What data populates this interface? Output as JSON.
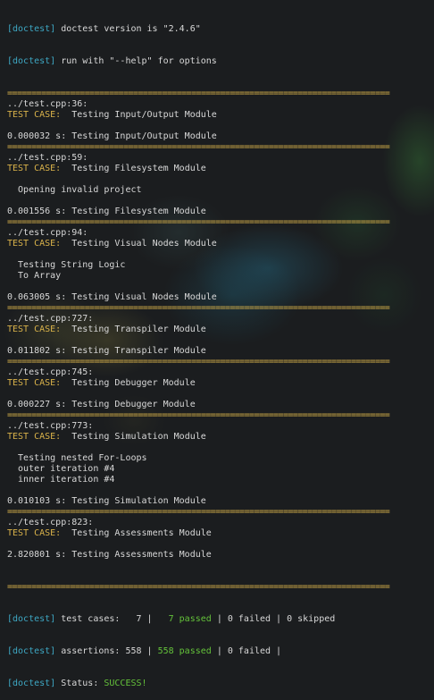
{
  "header": {
    "tag": "[doctest]",
    "version_text": " doctest version is \"2.4.6\"",
    "help_text": " run with \"--help\" for options"
  },
  "separator": "===============================================================================",
  "test_case_label": "TEST CASE:",
  "sections": [
    {
      "location": "../test.cpp:36:",
      "name": "  Testing Input/Output Module",
      "messages": [],
      "time": "0.000032 s: Testing Input/Output Module"
    },
    {
      "location": "../test.cpp:59:",
      "name": "  Testing Filesystem Module",
      "messages": [
        "  Opening invalid project"
      ],
      "time": "0.001556 s: Testing Filesystem Module"
    },
    {
      "location": "../test.cpp:94:",
      "name": "  Testing Visual Nodes Module",
      "messages": [
        "  Testing String Logic",
        "  To Array"
      ],
      "time": "0.063005 s: Testing Visual Nodes Module"
    },
    {
      "location": "../test.cpp:727:",
      "name": "  Testing Transpiler Module",
      "messages": [],
      "time": "0.011802 s: Testing Transpiler Module"
    },
    {
      "location": "../test.cpp:745:",
      "name": "  Testing Debugger Module",
      "messages": [],
      "time": "0.000227 s: Testing Debugger Module"
    },
    {
      "location": "../test.cpp:773:",
      "name": "  Testing Simulation Module",
      "messages": [
        "  Testing nested For-Loops",
        "  outer iteration #4",
        "  inner iteration #4"
      ],
      "time": "0.010103 s: Testing Simulation Module"
    },
    {
      "location": "../test.cpp:823:",
      "name": "  Testing Assessments Module",
      "messages": [],
      "time": "2.820801 s: Testing Assessments Module"
    }
  ],
  "summary": {
    "tag": "[doctest]",
    "test_cases_label": " test cases:   7 | ",
    "test_cases_passed": "  7 passed",
    "test_cases_rest": " | 0 failed | 0 skipped",
    "assertions_label": " assertions: 558 | ",
    "assertions_passed": "558 passed",
    "assertions_rest": " | 0 failed |",
    "status_label": " Status: ",
    "status_value": "SUCCESS!"
  },
  "colors": {
    "tag": "#3ea8c4",
    "test_case": "#d9b24a",
    "passed": "#64c23a",
    "text": "#d8d8d8"
  }
}
